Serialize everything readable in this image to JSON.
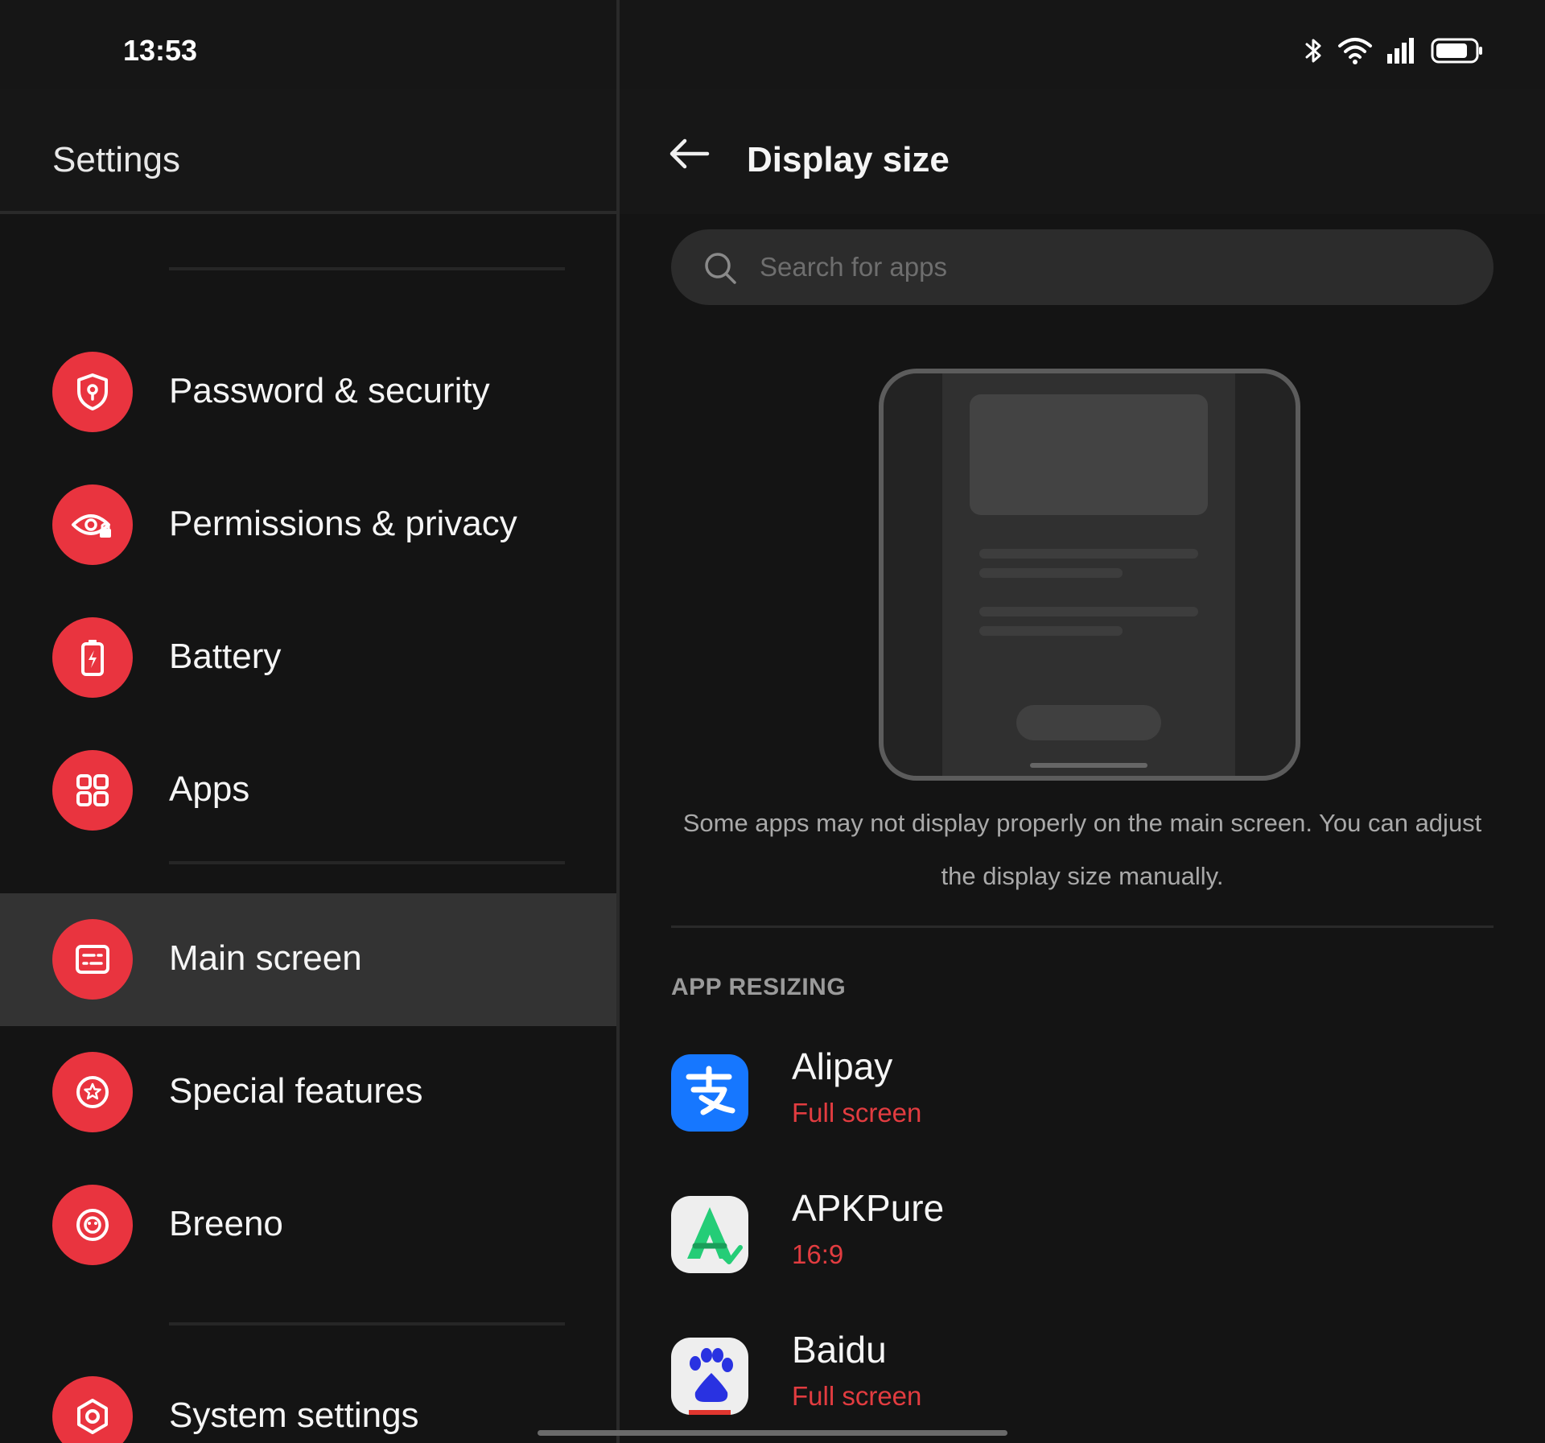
{
  "status_bar": {
    "time": "13:53",
    "icons": [
      "bluetooth-icon",
      "wifi-icon",
      "cellular-signal-icon",
      "battery-icon"
    ]
  },
  "left_panel": {
    "title": "Settings",
    "items": [
      {
        "label": "Password & security",
        "icon": "shield-lock-icon",
        "selected": false
      },
      {
        "label": "Permissions & privacy",
        "icon": "eye-lock-icon",
        "selected": false
      },
      {
        "label": "Battery",
        "icon": "battery-charge-icon",
        "selected": false
      },
      {
        "label": "Apps",
        "icon": "apps-grid-icon",
        "selected": false
      },
      {
        "label": "Main screen",
        "icon": "main-screen-icon",
        "selected": true
      },
      {
        "label": "Special features",
        "icon": "star-circle-icon",
        "selected": false
      },
      {
        "label": "Breeno",
        "icon": "breeno-icon",
        "selected": false
      },
      {
        "label": "System settings",
        "icon": "gear-icon",
        "selected": false
      }
    ]
  },
  "right_panel": {
    "title": "Display size",
    "back_icon": "arrow-left-icon",
    "search": {
      "placeholder": "Search for apps",
      "value": ""
    },
    "description": "Some apps may not display properly on the main screen. You can adjust the display size manually.",
    "section_header": "APP RESIZING",
    "apps": [
      {
        "name": "Alipay",
        "mode": "Full screen",
        "icon": "alipay-icon"
      },
      {
        "name": "APKPure",
        "mode": "16:9",
        "icon": "apkpure-icon"
      },
      {
        "name": "Baidu",
        "mode": "Full screen",
        "icon": "baidu-icon"
      }
    ]
  },
  "colors": {
    "accent": "#e9343f",
    "background": "#141414",
    "selected_row": "#333333",
    "mode_text": "#e23c40"
  }
}
